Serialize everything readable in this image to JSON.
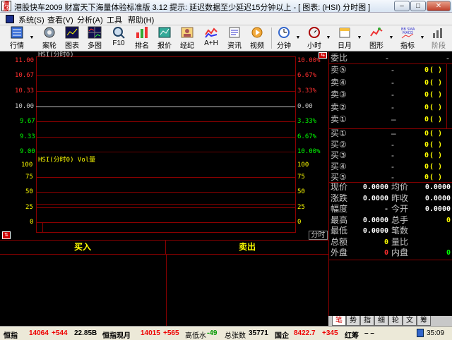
{
  "window": {
    "icon_text": "港股",
    "title": "港股快车2009 财富天下海量体验标准版 3.12 提示: 延迟数据至少延迟15分钟以上 - [ 图表: (HSI) 分时图 ]",
    "min": "–",
    "max": "□",
    "close": "✕"
  },
  "menu": [
    "系统(S)",
    "查看(V)",
    "分析(A)",
    "工具",
    "帮助(H)"
  ],
  "toolbar": [
    {
      "label": "行情",
      "icon": "list-icon",
      "arrow": true
    },
    {
      "label": "案轮",
      "icon": "gear-icon"
    },
    {
      "label": "图表",
      "icon": "chart-icon"
    },
    {
      "label": "多图",
      "icon": "multi-chart-icon"
    },
    {
      "label": "F10",
      "icon": "search-icon"
    },
    {
      "label": "排名",
      "icon": "ranking-icon"
    },
    {
      "label": "报价",
      "icon": "quote-icon"
    },
    {
      "label": "经纪",
      "icon": "broker-icon"
    },
    {
      "label": "A+H",
      "icon": "ah-icon"
    },
    {
      "label": "资讯",
      "icon": "news-icon"
    },
    {
      "label": "视频",
      "icon": "video-icon"
    },
    {
      "label": "分钟",
      "icon": "clock-icon",
      "arrow": true
    },
    {
      "label": "小时",
      "icon": "alarm-icon",
      "arrow": true
    },
    {
      "label": "日月",
      "icon": "calendar-icon",
      "arrow": true
    },
    {
      "label": "图形",
      "icon": "graph-icon",
      "arrow": true
    },
    {
      "label": "指标",
      "icon": "indicator-icon",
      "arrow": true
    },
    {
      "label": "阶段",
      "icon": "stage-icon"
    }
  ],
  "chart": {
    "price_title": "HSI(分时0)",
    "vol_title": "HSI(分时0) Vol量",
    "price_left": [
      "11.00",
      "10.67",
      "10.33",
      "10.00",
      "9.67",
      "9.33",
      "9.00"
    ],
    "price_right": [
      "10.00%",
      "6.67%",
      "3.33%",
      "0.00",
      "3.33%",
      "6.67%",
      "10.00%"
    ],
    "vol_left": [
      "100",
      "75",
      "50",
      "25",
      "0"
    ],
    "vol_right": [
      "100",
      "75",
      "50",
      "25",
      "0"
    ],
    "period_button": "分时"
  },
  "buysell": {
    "buy": "买入",
    "sell": "卖出"
  },
  "quote": {
    "weibi_label": "委比",
    "weibi_v1": "-",
    "weibi_v2": "-",
    "sell": [
      {
        "label": "卖⑤",
        "price": "-",
        "vol": "0",
        "p": "(    )"
      },
      {
        "label": "卖④",
        "price": "-",
        "vol": "0",
        "p": "(    )"
      },
      {
        "label": "卖③",
        "price": "-",
        "vol": "0",
        "p": "(    )"
      },
      {
        "label": "卖②",
        "price": "-",
        "vol": "0",
        "p": "(    )"
      },
      {
        "label": "卖①",
        "price": "–",
        "vol": "0",
        "p": "(    )"
      }
    ],
    "buy": [
      {
        "label": "买①",
        "price": "–",
        "vol": "0",
        "p": "(    )"
      },
      {
        "label": "买②",
        "price": "-",
        "vol": "0",
        "p": "(    )"
      },
      {
        "label": "买③",
        "price": "-",
        "vol": "0",
        "p": "(    )"
      },
      {
        "label": "买④",
        "price": "-",
        "vol": "0",
        "p": "(    )"
      },
      {
        "label": "买⑤",
        "price": "-",
        "vol": "0",
        "p": "(    )"
      }
    ],
    "stats": [
      {
        "l1": "现价",
        "v1": "0.0000",
        "l2": "均价",
        "v2": "0.0000"
      },
      {
        "l1": "涨跌",
        "v1": "0.0000",
        "l2": "昨收",
        "v2": "0.0000"
      },
      {
        "l1": "幅度",
        "v1": "-",
        "l2": "今开",
        "v2": "0.0000"
      },
      {
        "l1": "最高",
        "v1": "0.0000",
        "l2": "总手",
        "v2": "0"
      },
      {
        "l1": "最低",
        "v1": "0.0000",
        "l2": "笔数",
        "v2": ""
      },
      {
        "l1": "总额",
        "v1": "0",
        "l2": "量比",
        "v2": ""
      },
      {
        "l1": "外盘",
        "v1": "0",
        "l2": "内盘",
        "v2": "0"
      }
    ]
  },
  "right_tabs": [
    "笔",
    "势",
    "指",
    "细",
    "轮",
    "文",
    "筹"
  ],
  "status": {
    "hsi_label": "恒指",
    "hsi_val": "14064",
    "hsi_chg": "+544",
    "hsi_amt": "22.85B",
    "fut_label": "恒指现月",
    "fut_val": "14015",
    "fut_chg": "+565",
    "prem_label": "高低水",
    "prem_val": "-49",
    "cnt_label": "总张数",
    "cnt_val": "35771",
    "hsce_label": "国企",
    "hsce_val": "8422.7",
    "hsce_chg": "+345",
    "red_label": "红筹",
    "red_val": "–  –",
    "time": "35:09"
  },
  "colors": {
    "grid": "#8b0000",
    "up": "#ff3030",
    "down": "#00ff00",
    "neutral": "#ffffff",
    "accent": "#ffff00"
  }
}
